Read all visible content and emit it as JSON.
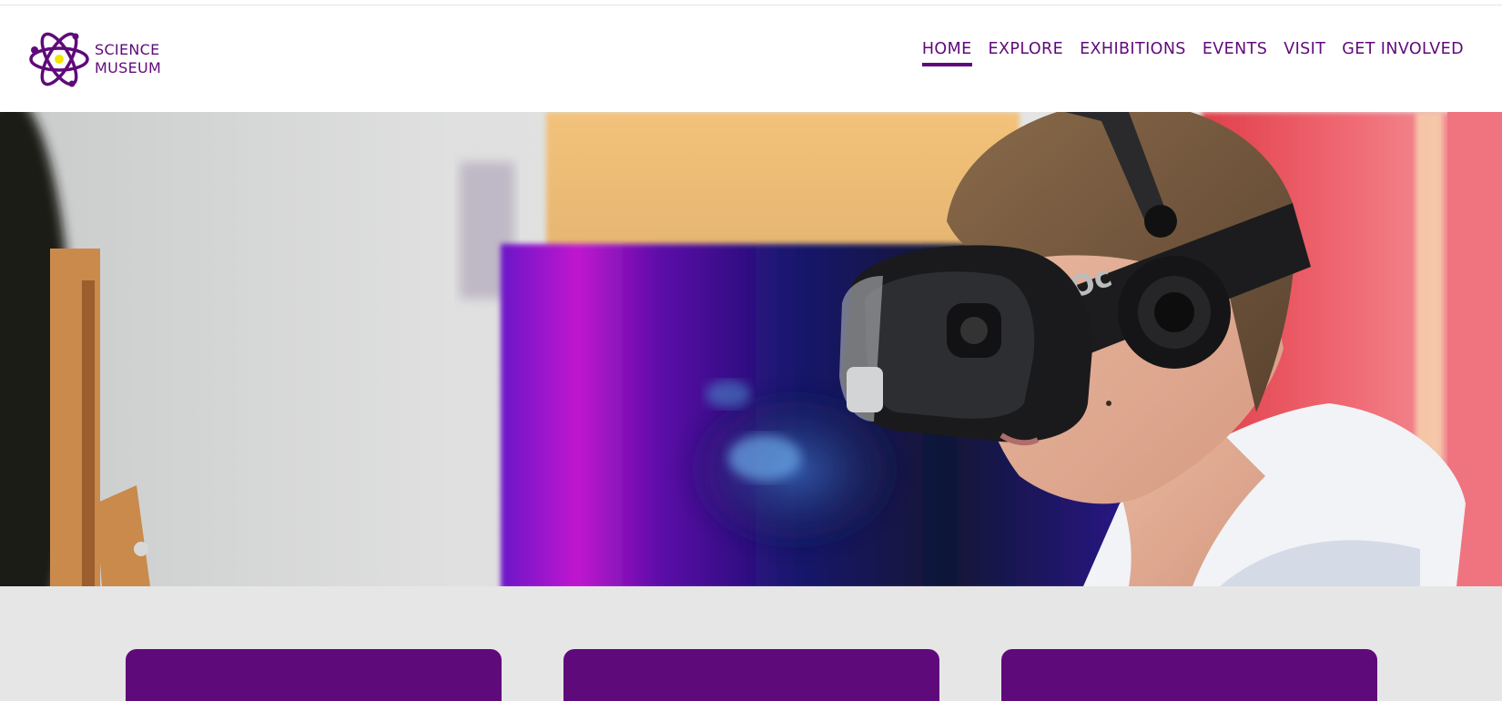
{
  "logo": {
    "line1": "SCIENCE",
    "line2": "MUSEUM",
    "icon": "atom-icon"
  },
  "nav": {
    "items": [
      {
        "label": "HOME",
        "active": true
      },
      {
        "label": "EXPLORE",
        "active": false
      },
      {
        "label": "EXHIBITIONS",
        "active": false
      },
      {
        "label": "EVENTS",
        "active": false
      },
      {
        "label": "VISIT",
        "active": false
      },
      {
        "label": "GET INVOLVED",
        "active": false
      }
    ]
  },
  "hero": {
    "image": "person-wearing-vr-headset-photo",
    "headset_text": "Oc"
  },
  "cards_count": 3,
  "colors": {
    "brand_purple": "#5f0a7a",
    "logo_dot": "#f2e600",
    "section_bg": "#e6e6e6",
    "header_bg": "#ffffff"
  }
}
